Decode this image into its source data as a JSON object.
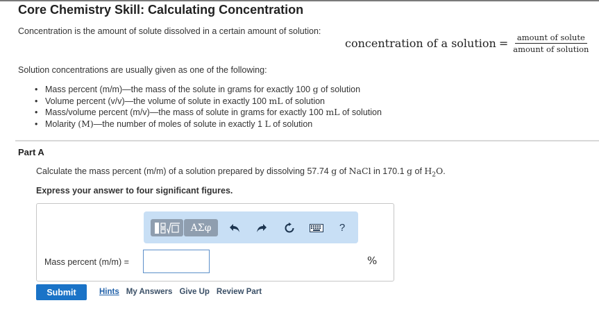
{
  "title": "Core Chemistry Skill: Calculating Concentration",
  "intro": "Concentration is the amount of solute dissolved in a certain amount of solution:",
  "formula": {
    "lhs": "concentration of a solution",
    "eq": "=",
    "numerator": "amount of solute",
    "denominator": "amount of solution"
  },
  "usually_given": "Solution concentrations are usually given as one of the following:",
  "bullets": [
    {
      "pre": "Mass percent (m/m)—the mass of the solute in grams for exactly 100 ",
      "unit": "g",
      "post": " of solution"
    },
    {
      "pre": "Volume percent (v/v)—the volume of solute in exactly 100 ",
      "unit": "mL",
      "post": " of solution"
    },
    {
      "pre": "Mass/volume percent (m/v)—the mass of solute in grams for exactly 100 ",
      "unit": "mL",
      "post": " of solution"
    },
    {
      "pre": "Molarity ",
      "unit": "(M)",
      "mid": "—the number of moles of solute in exactly 1 ",
      "unit2": "L",
      "post": " of solution"
    }
  ],
  "part_label": "Part A",
  "question": {
    "pre": "Calculate the mass percent (m/m) of a solution prepared by dissolving 57.74 ",
    "g1": "g",
    "of1": " of ",
    "nacl": "NaCl",
    "in": " in 170.1 ",
    "g2": "g",
    "of2": " of ",
    "h": "H",
    "sub": "2",
    "o": "O",
    "end": "."
  },
  "instruction": "Express your answer to four significant figures.",
  "answer": {
    "label": "Mass percent (m/m) =",
    "value": "",
    "unit": "%"
  },
  "toolbar": {
    "symbols_label": "ΑΣφ",
    "help_label": "?",
    "icons": [
      "template-fraction-root-icon",
      "greek-symbols-icon",
      "undo-icon",
      "redo-icon",
      "reset-icon",
      "keyboard-icon",
      "help-icon"
    ]
  },
  "actions": {
    "submit": "Submit",
    "hints": "Hints",
    "my_answers": "My Answers",
    "give_up": "Give Up",
    "review_part": "Review Part"
  },
  "colors": {
    "toolbar_bg": "#c8dff5",
    "tool_button": "#8f9eaf",
    "submit_bg": "#1a73c7",
    "input_border": "#5b8fc9"
  }
}
